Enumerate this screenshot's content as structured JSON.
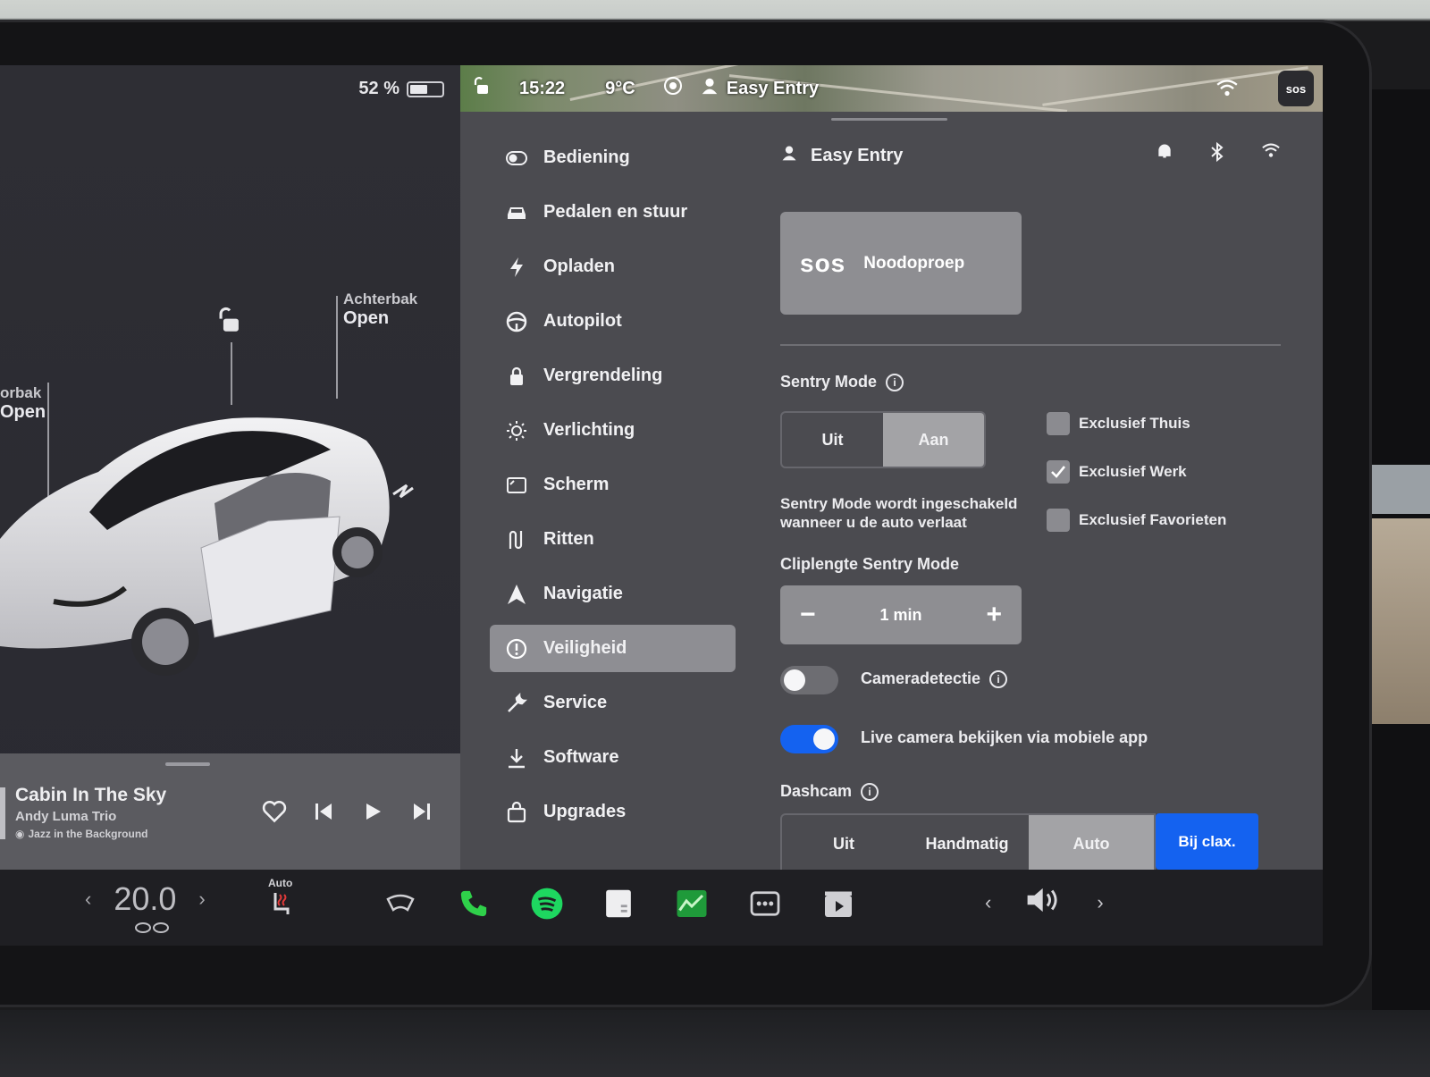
{
  "status": {
    "battery_percent": "52 %",
    "battery_level": 0.52,
    "time": "15:22",
    "temperature": "9°C",
    "profile": "Easy Entry"
  },
  "car": {
    "frunk_label": "orbak",
    "frunk_value": "Open",
    "trunk_label": "Achterbak",
    "trunk_value": "Open"
  },
  "media": {
    "song": "Cabin In The Sky",
    "artist": "Andy Luma Trio",
    "source": "Jazz in the Background"
  },
  "nav": [
    {
      "label": "Bediening",
      "icon": "toggle-icon"
    },
    {
      "label": "Pedalen en stuur",
      "icon": "car-icon"
    },
    {
      "label": "Opladen",
      "icon": "bolt-icon"
    },
    {
      "label": "Autopilot",
      "icon": "steering-wheel-icon"
    },
    {
      "label": "Vergrendeling",
      "icon": "lock-icon"
    },
    {
      "label": "Verlichting",
      "icon": "sun-icon"
    },
    {
      "label": "Scherm",
      "icon": "display-icon"
    },
    {
      "label": "Ritten",
      "icon": "trips-icon"
    },
    {
      "label": "Navigatie",
      "icon": "navigation-icon"
    },
    {
      "label": "Veiligheid",
      "icon": "safety-icon",
      "active": true
    },
    {
      "label": "Service",
      "icon": "wrench-icon"
    },
    {
      "label": "Software",
      "icon": "download-icon"
    },
    {
      "label": "Upgrades",
      "icon": "bag-icon"
    }
  ],
  "safety": {
    "profile_name": "Easy Entry",
    "sos_logo": "sos",
    "sos_label": "Noodoproep",
    "sentry_title": "Sentry Mode",
    "sentry_off": "Uit",
    "sentry_on": "Aan",
    "sentry_desc_line1": "Sentry Mode wordt ingeschakeld",
    "sentry_desc_line2": "wanneer u de auto verlaat",
    "check_home": "Exclusief Thuis",
    "check_work": "Exclusief Werk",
    "check_favorites": "Exclusief Favorieten",
    "check_work_checked": true,
    "clip_title": "Cliplengte Sentry Mode",
    "clip_value": "1 min",
    "camera_detect": "Cameradetectie",
    "camera_detect_on": false,
    "live_camera": "Live camera bekijken via mobiele app",
    "live_camera_on": true,
    "dashcam_title": "Dashcam",
    "dashcam_off": "Uit",
    "dashcam_manual": "Handmatig",
    "dashcam_auto": "Auto",
    "dashcam_honk": "Bij clax."
  },
  "taskbar": {
    "temperature": "20.0",
    "seat_mode": "Auto"
  },
  "colors": {
    "accent_blue": "#1462f0",
    "phone_green": "#2fd04a",
    "spotify_green": "#1ed760"
  }
}
